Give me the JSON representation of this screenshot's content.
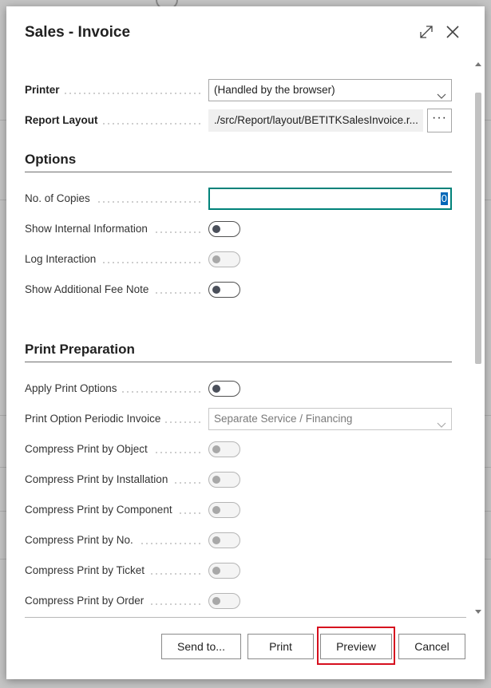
{
  "dialog": {
    "title": "Sales - Invoice",
    "expand_icon": "expand-icon",
    "close_icon": "close-icon"
  },
  "fields": {
    "printer": {
      "label": "Printer",
      "value": "(Handled by the browser)"
    },
    "report_layout": {
      "label": "Report Layout",
      "value": "./src/Report/layout/BETITKSalesInvoice.r...",
      "button": "···"
    }
  },
  "options": {
    "heading": "Options",
    "copies": {
      "label": "No. of Copies",
      "value": "0"
    },
    "show_internal": {
      "label": "Show Internal Information",
      "on": false,
      "enabled": true
    },
    "log_interaction": {
      "label": "Log Interaction",
      "on": false,
      "enabled": false
    },
    "show_fee_note": {
      "label": "Show Additional Fee Note",
      "on": false,
      "enabled": true
    }
  },
  "print_prep": {
    "heading": "Print Preparation",
    "apply_print_options": {
      "label": "Apply Print Options",
      "on": false,
      "enabled": true
    },
    "periodic_invoice": {
      "label": "Print Option Periodic Invoice",
      "value": "Separate Service / Financing"
    },
    "compress_object": {
      "label": "Compress Print by Object",
      "on": false,
      "enabled": false
    },
    "compress_installation": {
      "label": "Compress Print by Installation",
      "on": false,
      "enabled": false
    },
    "compress_component": {
      "label": "Compress Print by Component",
      "on": false,
      "enabled": false
    },
    "compress_no": {
      "label": "Compress Print by No.",
      "on": false,
      "enabled": false
    },
    "compress_ticket": {
      "label": "Compress Print by Ticket",
      "on": false,
      "enabled": false
    },
    "compress_order": {
      "label": "Compress Print by Order",
      "on": false,
      "enabled": false
    }
  },
  "buttons": {
    "send_to": "Send to...",
    "print": "Print",
    "preview": "Preview",
    "cancel": "Cancel"
  },
  "colors": {
    "accent": "#00827a",
    "highlight": "#d60f1e",
    "selection": "#0067b8"
  }
}
